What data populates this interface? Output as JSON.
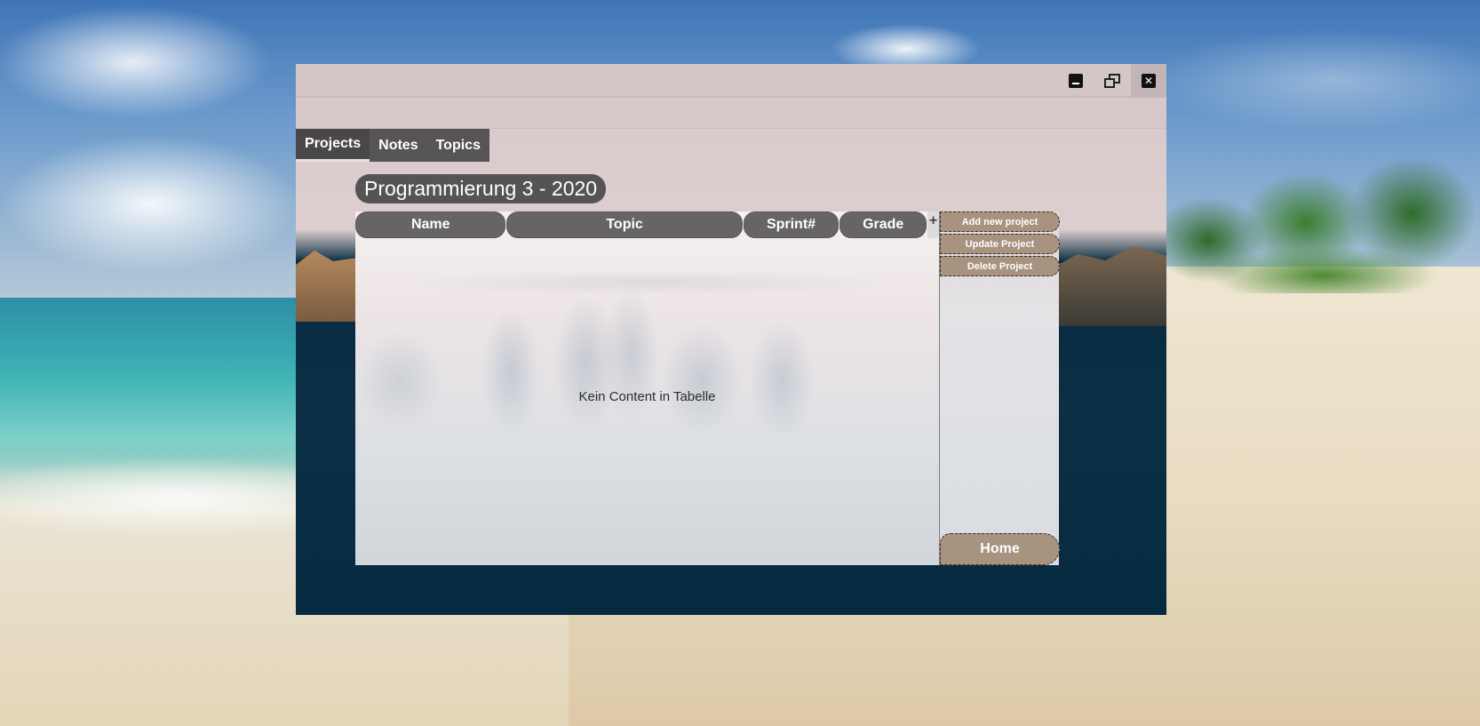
{
  "window": {
    "controls": {
      "minimize_icon": "minimize-icon",
      "restore_icon": "restore-icon",
      "close_icon": "close-icon",
      "close_glyph": "✕"
    }
  },
  "tabs": [
    {
      "label": "Projects",
      "active": true
    },
    {
      "label": "Notes",
      "active": false
    },
    {
      "label": "Topics",
      "active": false
    }
  ],
  "main": {
    "semester_title": "Programmierung 3 - 2020",
    "table": {
      "columns": [
        "Name",
        "Topic",
        "Sprint#",
        "Grade"
      ],
      "column_menu_glyph": "+",
      "rows": [],
      "empty_message": "Kein Content in Tabelle"
    }
  },
  "actions": {
    "add_label": "Add new project",
    "update_label": "Update Project",
    "delete_label": "Delete Project",
    "home_label": "Home"
  },
  "colors": {
    "tab_bar": "#575456",
    "header_cell": "#666465",
    "button": "#a89280",
    "window_bottom": "#062a3f",
    "titlebar": "#d4c5c7"
  }
}
